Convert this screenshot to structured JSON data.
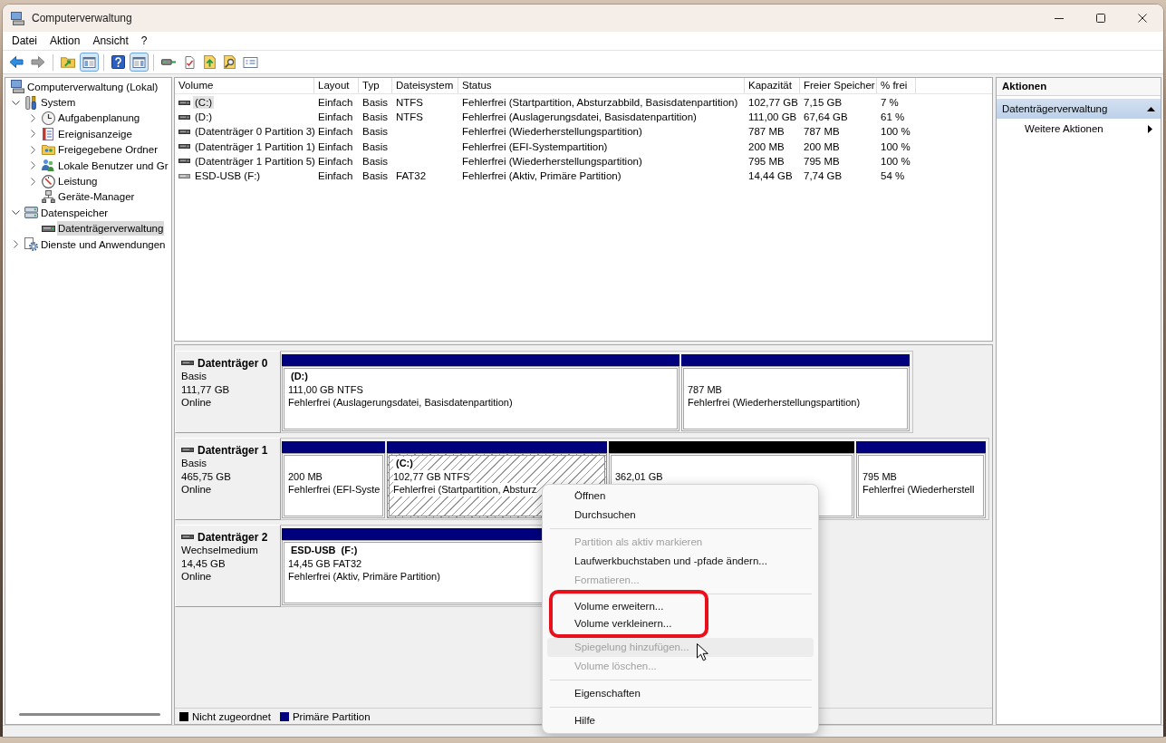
{
  "window": {
    "title": "Computerverwaltung"
  },
  "menu_bar": [
    {
      "label": "Datei"
    },
    {
      "label": "Aktion"
    },
    {
      "label": "Ansicht"
    },
    {
      "label": "?"
    }
  ],
  "toolbar": [
    {
      "buttons": [
        {
          "kind": "back",
          "pressed": false,
          "disabled": false
        },
        {
          "kind": "forward",
          "pressed": false,
          "disabled": true
        }
      ]
    },
    {
      "buttons": [
        {
          "kind": "up",
          "pressed": false,
          "disabled": false
        },
        {
          "kind": "console-tree",
          "pressed": true,
          "disabled": false
        }
      ]
    },
    {
      "buttons": [
        {
          "kind": "help",
          "pressed": false,
          "disabled": false
        },
        {
          "kind": "action-pane",
          "pressed": true,
          "disabled": false
        }
      ]
    },
    {
      "buttons": [
        {
          "kind": "connect",
          "pressed": false,
          "disabled": false
        },
        {
          "kind": "check",
          "pressed": false,
          "disabled": false
        },
        {
          "kind": "import",
          "pressed": false,
          "disabled": false
        },
        {
          "kind": "search",
          "pressed": false,
          "disabled": false
        },
        {
          "kind": "properties",
          "pressed": false,
          "disabled": false
        }
      ]
    }
  ],
  "tree": {
    "items": [
      {
        "label": "Computerverwaltung (Lokal)",
        "kind": "computer",
        "selected": false,
        "children": [
          {
            "label": "System",
            "kind": "tools",
            "expandable": true,
            "expanded": true,
            "selected": false,
            "children": [
              {
                "label": "Aufgabenplanung",
                "kind": "scheduler",
                "expandable": true,
                "expanded": false,
                "selected": false
              },
              {
                "label": "Ereignisanzeige",
                "kind": "events",
                "expandable": true,
                "expanded": false,
                "selected": false
              },
              {
                "label": "Freigegebene Ordner",
                "kind": "shares",
                "expandable": true,
                "expanded": false,
                "selected": false
              },
              {
                "label": "Lokale Benutzer und Gr",
                "kind": "users",
                "expandable": true,
                "expanded": false,
                "selected": false
              },
              {
                "label": "Leistung",
                "kind": "performance",
                "expandable": true,
                "expanded": false,
                "selected": false
              },
              {
                "label": "Geräte-Manager",
                "kind": "devices",
                "expandable": false,
                "expanded": false,
                "selected": false
              }
            ]
          },
          {
            "label": "Datenspeicher",
            "kind": "storage",
            "expandable": true,
            "expanded": true,
            "selected": false,
            "children": [
              {
                "label": "Datenträgerverwaltung",
                "kind": "disks",
                "expandable": false,
                "expanded": false,
                "selected": true
              }
            ]
          },
          {
            "label": "Dienste und Anwendungen",
            "kind": "services",
            "expandable": true,
            "expanded": false,
            "selected": false
          }
        ]
      }
    ]
  },
  "volume_table": {
    "columns": [
      "Volume",
      "Layout",
      "Typ",
      "Dateisystem",
      "Status",
      "Kapazität",
      "Freier Speicher",
      "% frei"
    ],
    "rows": [
      {
        "kind": "fixed",
        "selected": true,
        "volume": "(C:)",
        "layout": "Einfach",
        "type": "Basis",
        "file_system": "NTFS",
        "status": "Fehlerfrei (Startpartition, Absturzabbild, Basisdatenpartition)",
        "capacity": "102,77 GB",
        "free_space": "7,15 GB",
        "percent_free": "7 %"
      },
      {
        "kind": "fixed",
        "selected": false,
        "volume": "(D:)",
        "layout": "Einfach",
        "type": "Basis",
        "file_system": "NTFS",
        "status": "Fehlerfrei (Auslagerungsdatei, Basisdatenpartition)",
        "capacity": "111,00 GB",
        "free_space": "67,64 GB",
        "percent_free": "61 %"
      },
      {
        "kind": "fixed",
        "selected": false,
        "volume": "(Datenträger 0 Partition 3)",
        "layout": "Einfach",
        "type": "Basis",
        "status": "Fehlerfrei (Wiederherstellungspartition)",
        "capacity": "787 MB",
        "free_space": "787 MB",
        "percent_free": "100 %"
      },
      {
        "kind": "fixed",
        "selected": false,
        "volume": "(Datenträger 1 Partition 1)",
        "layout": "Einfach",
        "type": "Basis",
        "status": "Fehlerfrei (EFI-Systempartition)",
        "capacity": "200 MB",
        "free_space": "200 MB",
        "percent_free": "100 %"
      },
      {
        "kind": "fixed",
        "selected": false,
        "volume": "(Datenträger 1 Partition 5)",
        "layout": "Einfach",
        "type": "Basis",
        "status": "Fehlerfrei (Wiederherstellungspartition)",
        "capacity": "795 MB",
        "free_space": "795 MB",
        "percent_free": "100 %"
      },
      {
        "kind": "removable",
        "selected": false,
        "volume": "ESD-USB (F:)",
        "layout": "Einfach",
        "type": "Basis",
        "file_system": "FAT32",
        "status": "Fehlerfrei (Aktiv, Primäre Partition)",
        "capacity": "14,44 GB",
        "free_space": "7,74 GB",
        "percent_free": "54 %"
      }
    ]
  },
  "disks": [
    {
      "name": "Datenträger 0",
      "type": "Basis",
      "size": "111,77 GB",
      "status": "Online",
      "partitions": [
        {
          "kind": "primary",
          "selected": false,
          "name": "(D:)",
          "size": "111,00 GB NTFS",
          "status": "Fehlerfrei (Auslagerungsdatei, Basisdatenpartition)"
        },
        {
          "kind": "primary",
          "selected": false,
          "size": "787 MB",
          "status": "Fehlerfrei (Wiederherstellungspartition)"
        }
      ]
    },
    {
      "name": "Datenträger 1",
      "type": "Basis",
      "size": "465,75 GB",
      "status": "Online",
      "partitions": [
        {
          "kind": "primary",
          "selected": false,
          "size": "200 MB",
          "status": "Fehlerfrei (EFI-Syste"
        },
        {
          "kind": "primary",
          "selected": true,
          "name": "(C:)",
          "size": "102,77 GB NTFS",
          "status": "Fehlerfrei (Startpartition, Absturz"
        },
        {
          "kind": "unallocated",
          "selected": false,
          "size": "362,01 GB"
        },
        {
          "kind": "primary",
          "selected": false,
          "size": "795 MB",
          "status": "Fehlerfrei (Wiederherstell"
        }
      ]
    },
    {
      "name": "Datenträger 2",
      "type": "Wechselmedium",
      "size": "14,45 GB",
      "status": "Online",
      "partitions": [
        {
          "kind": "primary",
          "selected": false,
          "name": "ESD-USB  (F:)",
          "size": "14,45 GB FAT32",
          "status": "Fehlerfrei (Aktiv, Primäre Partition)"
        }
      ]
    }
  ],
  "legend": [
    {
      "label": "Nicht zugeordnet",
      "color": "#000000"
    },
    {
      "label": "Primäre Partition",
      "color": "#00007f"
    }
  ],
  "actions": {
    "title": "Aktionen",
    "sections": [
      {
        "label": "Datenträgerverwaltung",
        "expanded": true,
        "items": [
          {
            "label": "Weitere Aktionen",
            "has_submenu": true
          }
        ]
      }
    ]
  },
  "context_menu": {
    "groups": [
      {
        "items": [
          {
            "label": "Öffnen",
            "disabled": false,
            "highlighted": false,
            "outlined": false
          },
          {
            "label": "Durchsuchen",
            "disabled": false,
            "highlighted": false,
            "outlined": false
          }
        ]
      },
      {
        "items": [
          {
            "label": "Partition als aktiv markieren",
            "disabled": true,
            "highlighted": false,
            "outlined": false
          },
          {
            "label": "Laufwerkbuchstaben und -pfade ändern...",
            "disabled": false,
            "highlighted": false,
            "outlined": false
          },
          {
            "label": "Formatieren...",
            "disabled": true,
            "highlighted": false,
            "outlined": false
          }
        ]
      },
      {
        "items": [
          {
            "label": "Volume erweitern...",
            "disabled": false,
            "highlighted": false,
            "outlined": true
          },
          {
            "label": "Volume verkleinern...",
            "disabled": false,
            "highlighted": false,
            "outlined": true
          },
          {
            "label": "Spiegelung hinzufügen...",
            "disabled": true,
            "highlighted": true,
            "outlined": false
          },
          {
            "label": "Volume löschen...",
            "disabled": true,
            "highlighted": false,
            "outlined": false
          }
        ]
      },
      {
        "items": [
          {
            "label": "Eigenschaften",
            "disabled": false,
            "highlighted": false,
            "outlined": false
          }
        ]
      },
      {
        "items": [
          {
            "label": "Hilfe",
            "disabled": false,
            "highlighted": false,
            "outlined": false
          }
        ]
      }
    ]
  }
}
